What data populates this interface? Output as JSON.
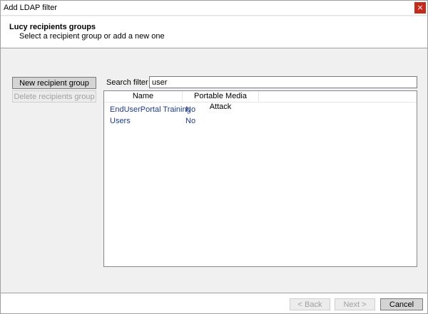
{
  "window": {
    "title": "Add LDAP filter",
    "close_glyph": "×"
  },
  "header": {
    "title": "Lucy recipients groups",
    "subtitle": "Select a recipient group or add a new one"
  },
  "left_panel": {
    "new_button": "New recipient group",
    "delete_button": "Delete recipients group"
  },
  "search": {
    "label": "Search filter",
    "value": "user"
  },
  "grid": {
    "columns": [
      "Name",
      "Portable Media Attack"
    ],
    "rows": [
      {
        "name": "EndUserPortal Training",
        "pma": "No"
      },
      {
        "name": "Users",
        "pma": "No"
      }
    ]
  },
  "footer": {
    "back": "< Back",
    "next": "Next >",
    "cancel": "Cancel"
  }
}
